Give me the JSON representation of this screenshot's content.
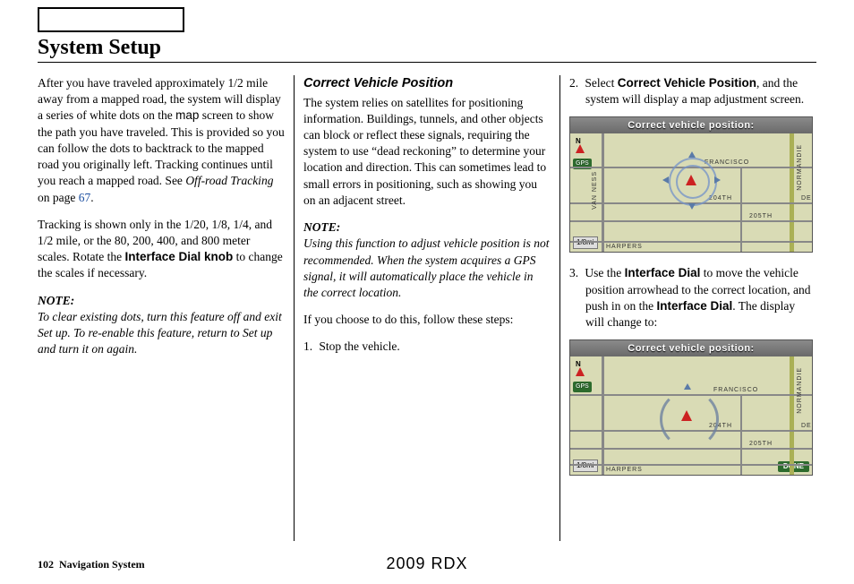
{
  "title": "System Setup",
  "col1": {
    "p1a": "After you have traveled approximately 1/2 mile away from a mapped road, the system will display a series of white dots on the ",
    "map_word": "map",
    "p1b": " screen to show the path you have traveled. This is provided so you can follow the dots to backtrack to the mapped road you originally left. Tracking continues until you reach a mapped road. See ",
    "off_road": "Off-road Tracking",
    "on_page": " on page ",
    "page_link": "67",
    "p1c": ".",
    "p2a": "Tracking is shown only in the 1/20, 1/8, 1/4, and 1/2 mile, or the 80, 200, 400, and 800 meter scales. Rotate the ",
    "dial_knob": "Interface Dial knob",
    "p2b": " to change the scales if necessary.",
    "note_head": "NOTE:",
    "note_body": "To clear existing dots, turn this feature off and exit Set up. To re-enable this feature, return to Set up and turn it on again."
  },
  "col2": {
    "subhead": "Correct Vehicle Position",
    "p1": "The system relies on satellites for positioning information. Buildings, tunnels, and other objects can block or reflect these signals, requiring the system to use “dead reckoning” to determine your location and direction. This can sometimes lead to small errors in positioning, such as showing you on an adjacent street.",
    "note_head": "NOTE:",
    "note_body": "Using this function to adjust vehicle position is not recommended. When the system acquires a GPS signal, it will automatically place the vehicle in the correct location.",
    "p2": "If you choose to do this, follow these steps:",
    "step1": "Stop the vehicle."
  },
  "col3": {
    "step2a": "Select ",
    "step2b": "Correct Vehicle Position",
    "step2c": ", and the system will display a map adjustment screen.",
    "step3a": "Use the ",
    "step3b": "Interface Dial",
    "step3c": " to move the vehicle position arrowhead to the correct location, and push in on the ",
    "step3d": "Interface Dial",
    "step3e": ". The display will change to:"
  },
  "map": {
    "header": "Correct vehicle position:",
    "gps": "GPS",
    "scale": "1/8mi",
    "done": "DONE",
    "n": "N",
    "streets": {
      "van_ness": "VAN NESS",
      "normandie": "NORMANDIE",
      "francisco": "FRANCISCO",
      "204th": "204TH",
      "205th": "205TH",
      "harpers": "HARPERS",
      "de": "DE"
    }
  },
  "footer": {
    "page_num": "102",
    "section": "Navigation System",
    "model": "2009 RDX"
  }
}
